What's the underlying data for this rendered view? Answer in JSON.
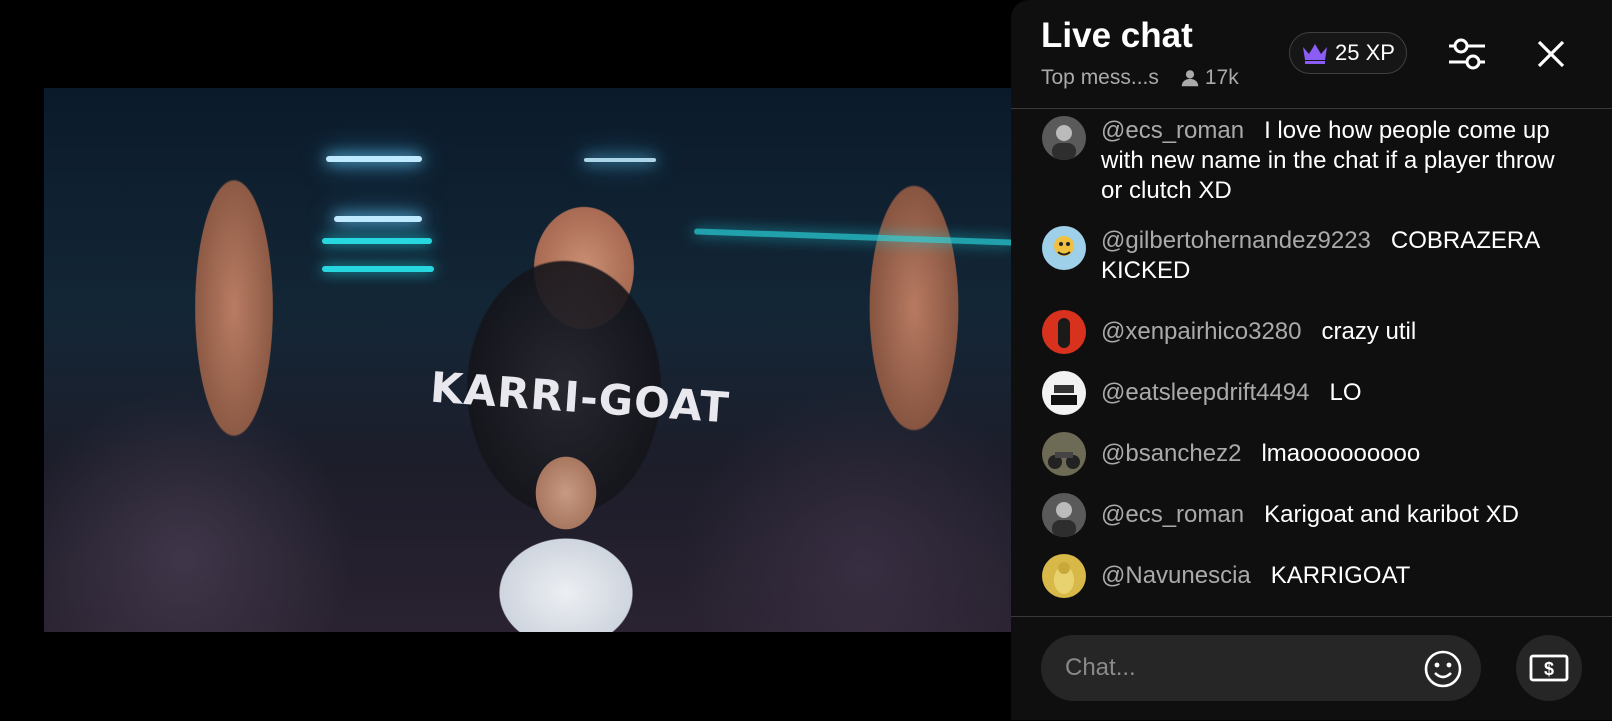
{
  "video": {
    "shirt_text": "KARRI-GOAT"
  },
  "chat": {
    "title": "Live chat",
    "mode": "Top mess...s",
    "viewer_count": "17k",
    "xp_label": "25 XP",
    "icons": {
      "crown": "crown-icon",
      "person": "person-icon",
      "settings": "sliders-icon",
      "close": "close-icon",
      "emoji": "emoji-icon",
      "super_chat": "dollar-bill-icon"
    },
    "colors": {
      "background": "#0f0f0f",
      "author": "#aaaaaa",
      "crown": "#8b5cf6"
    },
    "messages": [
      {
        "author": "@ecs_roman",
        "text": "I love how people come up with new name in the chat if a player throw or clutch XD",
        "avatar_color": "#5a5a5a"
      },
      {
        "author": "@gilbertohernandez9223",
        "text": "COBRAZERA KICKED",
        "avatar_color": "#9fd0ea"
      },
      {
        "author": "@xenpairhico3280",
        "text": "crazy util",
        "avatar_color": "#d8321e"
      },
      {
        "author": "@eatsleepdrift4494",
        "text": "LO",
        "avatar_color": "#f2f2f2"
      },
      {
        "author": "@bsanchez2",
        "text": "lmaooooooooo",
        "avatar_color": "#6d6a55"
      },
      {
        "author": "@ecs_roman",
        "text": "Karigoat and karibot XD",
        "avatar_color": "#5a5a5a"
      },
      {
        "author": "@Navunescia",
        "text": "KARRIGOAT",
        "avatar_color": "#d9b84a"
      }
    ],
    "input_placeholder": "Chat..."
  }
}
